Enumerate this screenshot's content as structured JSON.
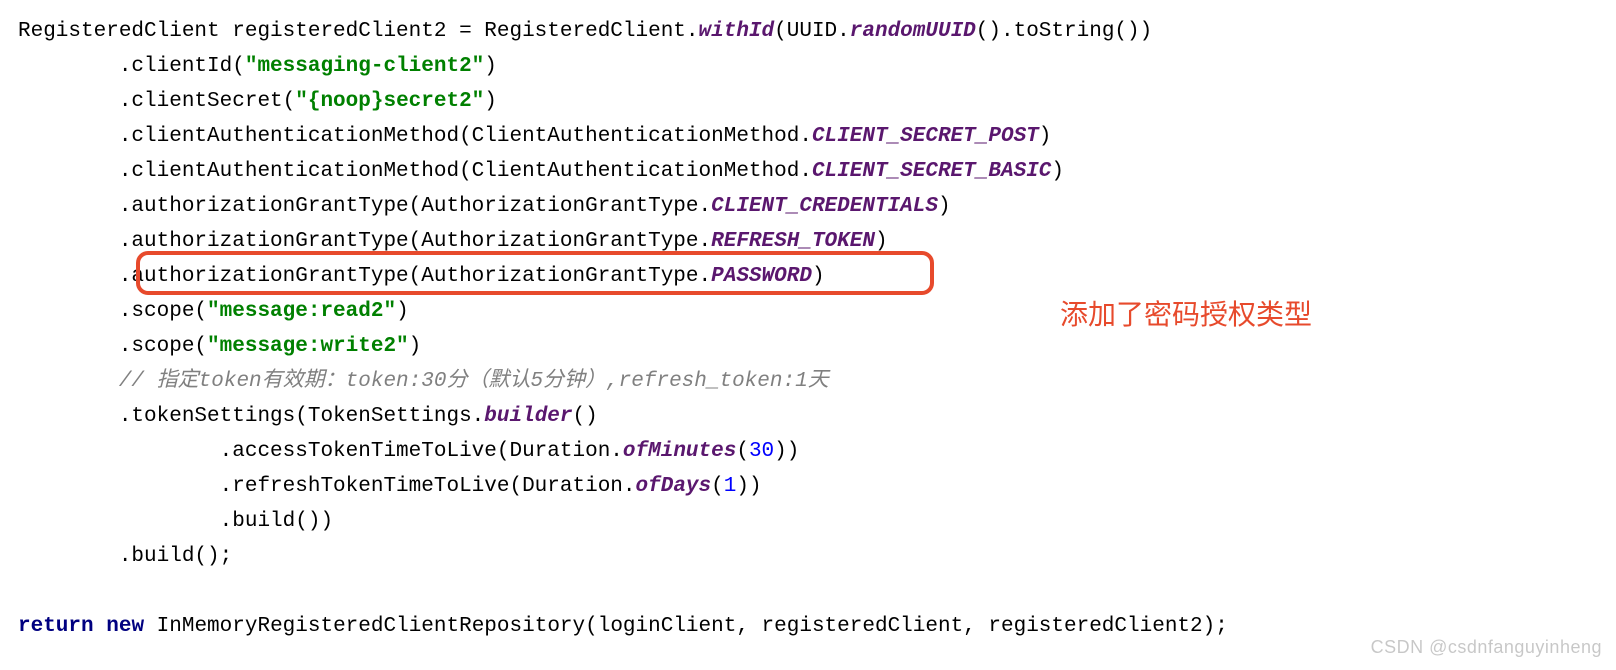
{
  "code": {
    "line1": {
      "a": "RegisteredClient registeredClient2 = RegisteredClient.",
      "b": "withId",
      "c": "(UUID.",
      "d": "randomUUID",
      "e": "().toString())"
    },
    "line2": {
      "a": "        .clientId(",
      "s": "\"messaging-client2\"",
      "c": ")"
    },
    "line3": {
      "a": "        .clientSecret(",
      "s": "\"{noop}secret2\"",
      "c": ")"
    },
    "line4": {
      "a": "        .clientAuthenticationMethod(ClientAuthenticationMethod.",
      "b": "CLIENT_SECRET_POST",
      "c": ")"
    },
    "line5": {
      "a": "        .clientAuthenticationMethod(ClientAuthenticationMethod.",
      "b": "CLIENT_SECRET_BASIC",
      "c": ")"
    },
    "line6": {
      "a": "        .authorizationGrantType(AuthorizationGrantType.",
      "b": "CLIENT_CREDENTIALS",
      "c": ")"
    },
    "line7": {
      "a": "        .authorizationGrantType(AuthorizationGrantType.",
      "b": "REFRESH_TOKEN",
      "c": ")"
    },
    "line8": {
      "a": "        .authorizationGrantType(AuthorizationGrantType.",
      "b": "PASSWORD",
      "c": ")"
    },
    "line9": {
      "a": "        .scope(",
      "s": "\"message:read2\"",
      "c": ")"
    },
    "line10": {
      "a": "        .scope(",
      "s": "\"message:write2\"",
      "c": ")"
    },
    "line11": {
      "a": "        ",
      "cmt": "// 指定token有效期：token:30分（默认5分钟）,refresh_token:1天"
    },
    "line12": {
      "a": "        .tokenSettings(TokenSettings.",
      "b": "builder",
      "c": "()"
    },
    "line13": {
      "a": "                .accessTokenTimeToLive(Duration.",
      "b": "ofMinutes",
      "c": "(",
      "n": "30",
      "d": "))"
    },
    "line14": {
      "a": "                .refreshTokenTimeToLive(Duration.",
      "b": "ofDays",
      "c": "(",
      "n": "1",
      "d": "))"
    },
    "line15": {
      "a": "                .build())"
    },
    "line16": {
      "a": "        .build();"
    },
    "line17": {
      "kw1": "return",
      "sp1": " ",
      "kw2": "new",
      "a": " InMemoryRegisteredClientRepository(loginClient, registeredClient, registeredClient2);"
    }
  },
  "annotation": "添加了密码授权类型",
  "watermark": "CSDN @csdnfanguyinheng"
}
